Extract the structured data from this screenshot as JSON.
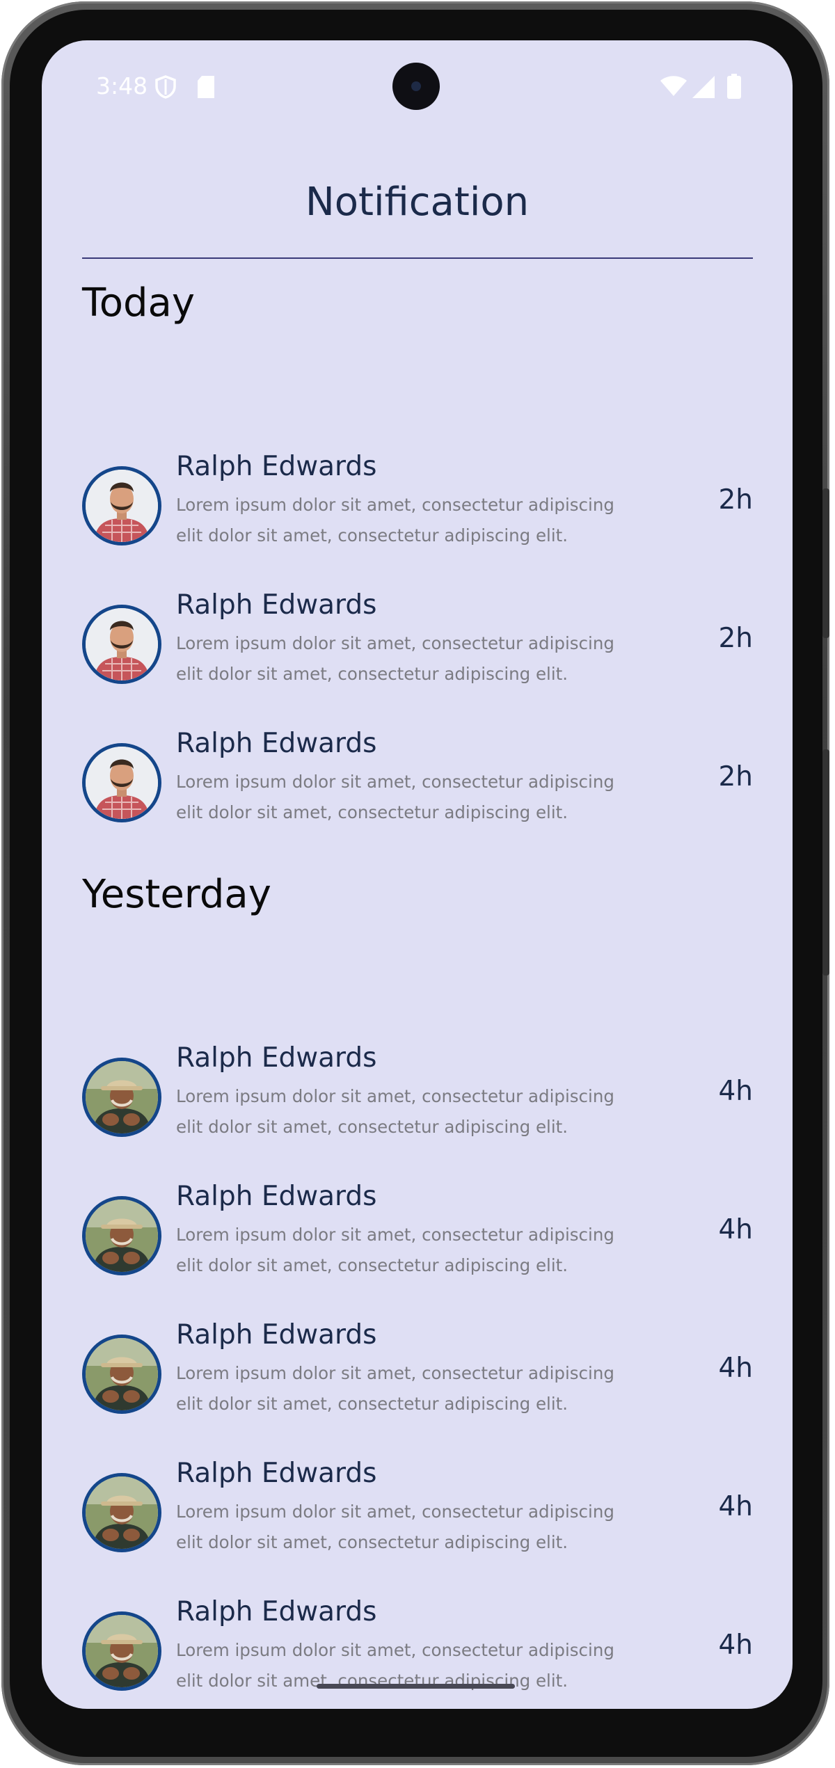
{
  "status_bar": {
    "time": "3:48",
    "icons": [
      "shield-icon",
      "sd-card-icon",
      "wifi-icon",
      "signal-icon",
      "battery-icon"
    ]
  },
  "header": {
    "title": "Notification"
  },
  "sections": {
    "today": {
      "label": "Today",
      "items": [
        {
          "name": "Ralph Edwards",
          "message": "Lorem ipsum dolor sit amet, consectetur adipiscing elit dolor sit amet, consectetur adipiscing elit.",
          "time": "2h"
        },
        {
          "name": "Ralph Edwards",
          "message": "Lorem ipsum dolor sit amet, consectetur adipiscing elit dolor sit amet, consectetur adipiscing elit.",
          "time": "2h"
        },
        {
          "name": "Ralph Edwards",
          "message": "Lorem ipsum dolor sit amet, consectetur adipiscing elit dolor sit amet, consectetur adipiscing elit.",
          "time": "2h"
        }
      ]
    },
    "yesterday": {
      "label": "Yesterday",
      "items": [
        {
          "name": "Ralph Edwards",
          "message": "Lorem ipsum dolor sit amet, consectetur adipiscing elit dolor sit amet, consectetur adipiscing elit.",
          "time": "4h"
        },
        {
          "name": "Ralph Edwards",
          "message": "Lorem ipsum dolor sit amet, consectetur adipiscing elit dolor sit amet, consectetur adipiscing elit.",
          "time": "4h"
        },
        {
          "name": "Ralph Edwards",
          "message": "Lorem ipsum dolor sit amet, consectetur adipiscing elit dolor sit amet, consectetur adipiscing elit.",
          "time": "4h"
        },
        {
          "name": "Ralph Edwards",
          "message": "Lorem ipsum dolor sit amet, consectetur adipiscing elit dolor sit amet, consectetur adipiscing elit.",
          "time": "4h"
        },
        {
          "name": "Ralph Edwards",
          "message": "Lorem ipsum dolor sit amet, consectetur adipiscing elit dolor sit amet, consectetur adipiscing elit.",
          "time": "4h"
        }
      ]
    }
  },
  "colors": {
    "screen_background": "#dfdff4",
    "title_text": "#1b2a4a",
    "divider": "#3a3a78",
    "avatar_ring": "#14468a",
    "message_text": "#7b7b82"
  }
}
